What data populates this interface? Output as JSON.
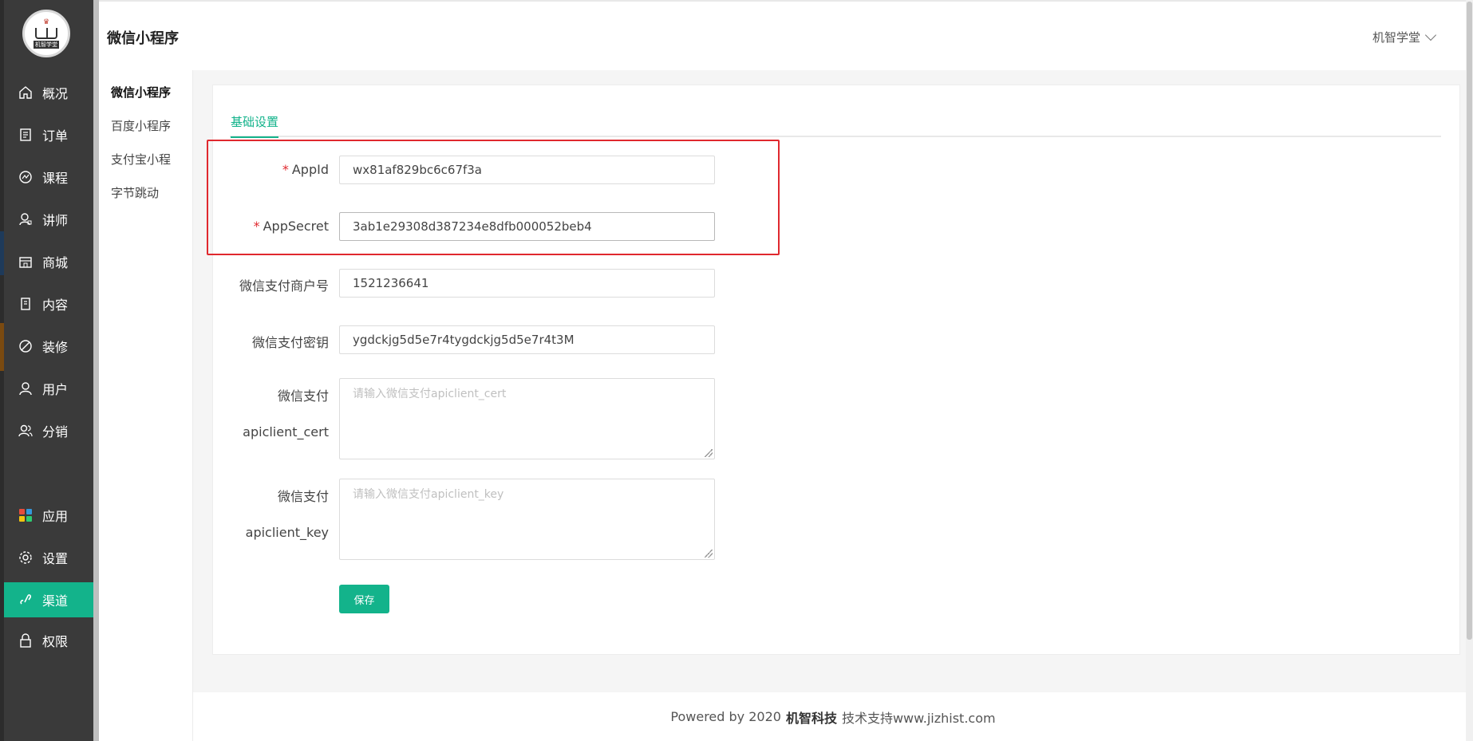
{
  "app": {
    "logo_text": "机智学堂"
  },
  "sidebar": {
    "items": [
      {
        "label": "概况",
        "icon": "home-icon"
      },
      {
        "label": "订单",
        "icon": "order-list-icon"
      },
      {
        "label": "课程",
        "icon": "chart-circle-icon"
      },
      {
        "label": "讲师",
        "icon": "teacher-icon"
      },
      {
        "label": "商城",
        "icon": "store-icon"
      },
      {
        "label": "内容",
        "icon": "document-icon"
      },
      {
        "label": "装修",
        "icon": "palette-icon"
      },
      {
        "label": "用户",
        "icon": "user-icon"
      },
      {
        "label": "分销",
        "icon": "distribution-icon"
      },
      {
        "label": "应用",
        "icon": "apps-icon"
      },
      {
        "label": "设置",
        "icon": "gear-icon"
      },
      {
        "label": "渠道",
        "icon": "link-icon",
        "active": true
      },
      {
        "label": "权限",
        "icon": "lock-icon"
      }
    ]
  },
  "header": {
    "title": "微信小程序",
    "user_name": "机智学堂"
  },
  "subnav": {
    "items": [
      "微信小程序",
      "百度小程序",
      "支付宝小程",
      "字节跳动"
    ]
  },
  "tabs": {
    "active": "基础设置"
  },
  "form": {
    "appid_label": "AppId",
    "appid_value": "wx81af829bc6c67f3a",
    "appsecret_label": "AppSecret",
    "appsecret_value": "3ab1e29308d387234e8dfb000052beb4",
    "mchid_label": "微信支付商户号",
    "mchid_value": "1521236641",
    "paykey_label": "微信支付密钥",
    "paykey_value": "ygdckjg5d5e7r4tygdckjg5d5e7r4t3M",
    "cert_label_line1": "微信支付",
    "cert_label_line2": "apiclient_cert",
    "cert_placeholder": "请输入微信支付apiclient_cert",
    "key_label_line1": "微信支付",
    "key_label_line2": "apiclient_key",
    "key_placeholder": "请输入微信支付apiclient_key",
    "save_label": "保存",
    "required_mark": "*"
  },
  "footer": {
    "prefix": "Powered by 2020",
    "brand": "机智科技",
    "suffix": "技术支持www.jizhist.com"
  },
  "colors": {
    "accent": "#13b38b",
    "sidebar_bg": "#3a3a3a",
    "highlight_border": "#e0282e"
  }
}
